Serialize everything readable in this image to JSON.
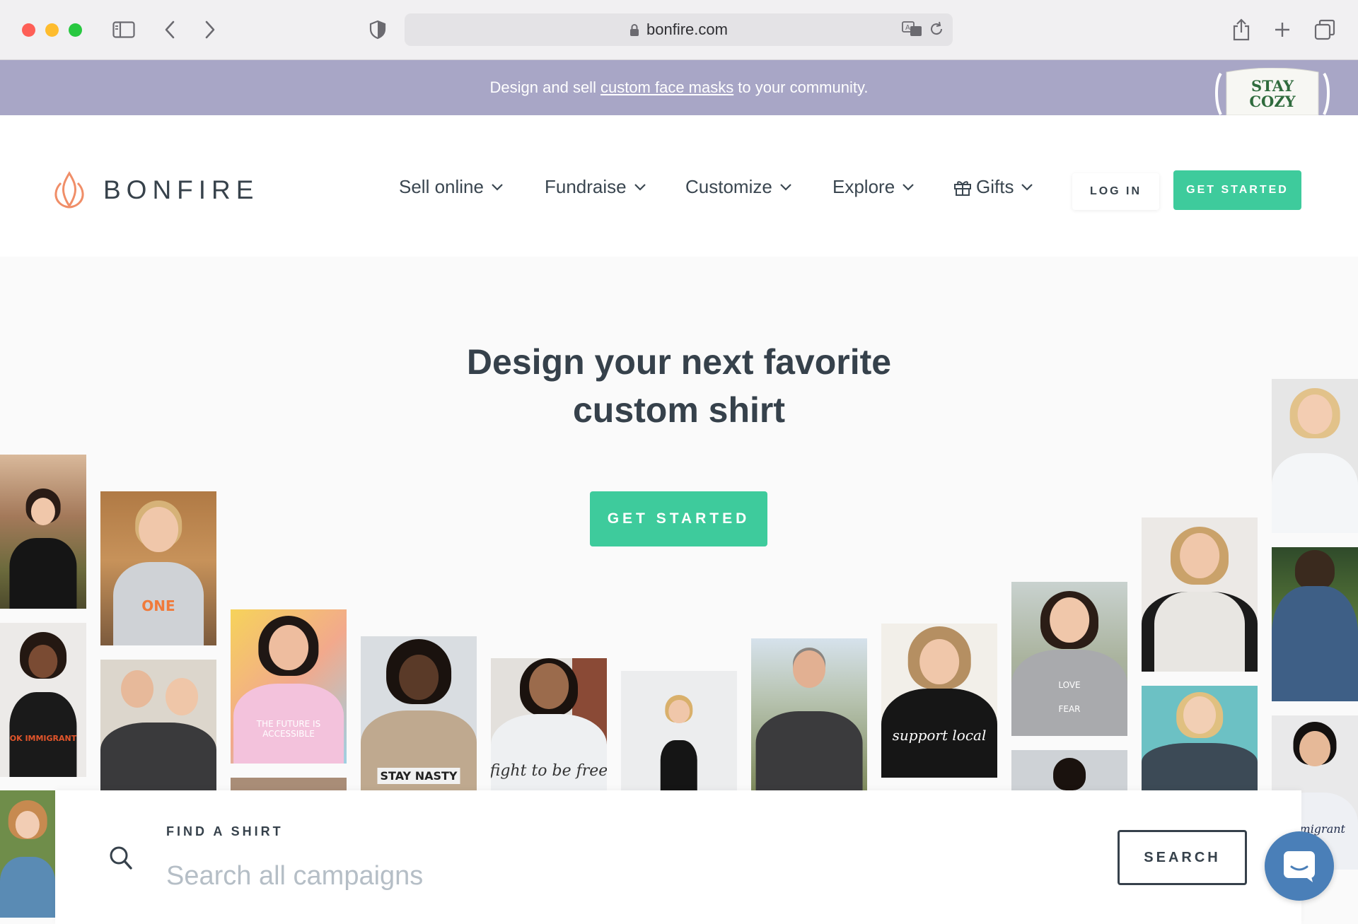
{
  "browser": {
    "url": "bonfire.com"
  },
  "promo": {
    "prefix": "Design and sell",
    "link": "custom face masks",
    "suffix": "to your community.",
    "mask_text_1": "STAY",
    "mask_text_2": "COZY"
  },
  "header": {
    "logo": "BONFIRE",
    "nav": [
      {
        "label": "Sell online"
      },
      {
        "label": "Fundraise"
      },
      {
        "label": "Customize"
      },
      {
        "label": "Explore"
      },
      {
        "label": "Gifts"
      }
    ],
    "login": "LOG IN",
    "get_started": "GET STARTED"
  },
  "hero": {
    "title_line1": "Design your next favorite",
    "title_line2": "custom shirt",
    "cta": "GET STARTED"
  },
  "photos": {
    "shirt_one": "ONE",
    "shirt_future": "THE FUTURE IS ACCESSIBLE",
    "shirt_nasty": "STAY NASTY",
    "shirt_fight": "fight to be free",
    "shirt_support": "support local",
    "shirt_love": "LOVE",
    "shirt_fear": "FEAR",
    "shirt_immigrant": "Immigrant",
    "shirt_ok": "OK IMMIGRANT"
  },
  "search": {
    "label": "FIND A SHIRT",
    "placeholder": "Search all campaigns",
    "button": "SEARCH"
  },
  "colors": {
    "accent": "#3ecb9c",
    "promo_bg": "#a8a6c6",
    "text_dark": "#36414b",
    "chat_bubble": "#4a7fb8"
  }
}
